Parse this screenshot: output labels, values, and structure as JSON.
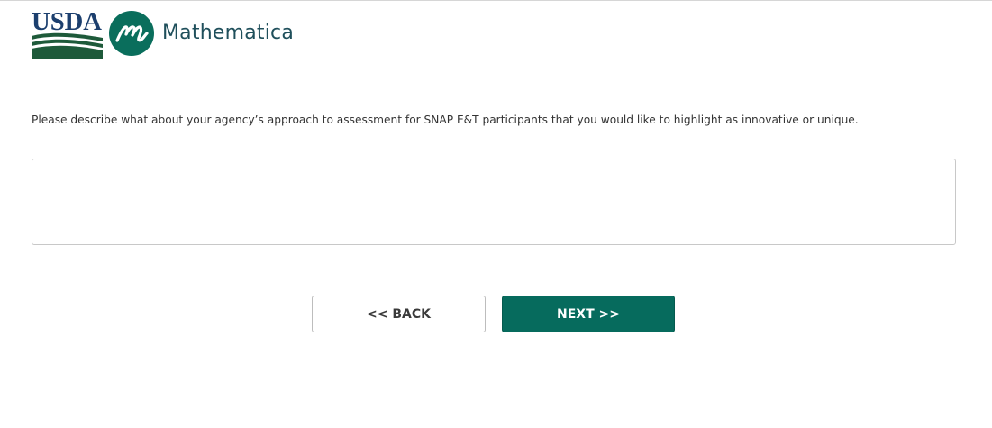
{
  "header": {
    "usda_logo_text": "USDA",
    "mathematica_logo_text": "Mathematica",
    "mathematica_mark_icon": "mathematica-m-icon",
    "colors": {
      "usda_green": "#1e5a3a",
      "usda_blue": "#1c3f6e",
      "mathematica_teal": "#0a6e5c",
      "mathematica_text": "#1f4f5b"
    }
  },
  "form": {
    "question": "Please describe what about your agency’s approach to assessment for SNAP E&T participants that you would like to highlight as innovative or unique.",
    "answer_value": "",
    "answer_placeholder": ""
  },
  "navigation": {
    "back_label": "<< BACK",
    "next_label": "NEXT >>",
    "next_color": "#066b5d"
  }
}
